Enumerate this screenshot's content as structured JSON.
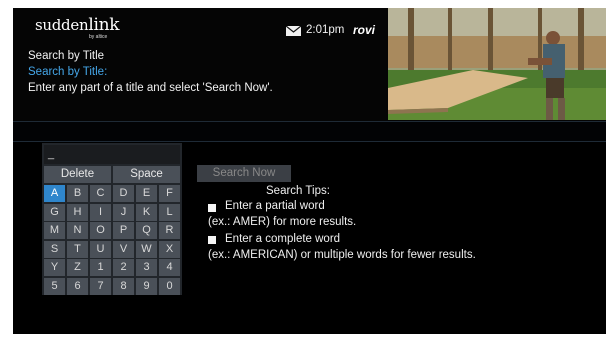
{
  "header": {
    "logo": {
      "brand": "sudden",
      "brand_bold": "link",
      "sub": "by altice"
    },
    "title": "Search by Title",
    "subtitle": "Search by Title:",
    "instruction": "Enter any part of a title and select 'Search Now'.",
    "time": "2:01pm",
    "provider": "rovi",
    "mail_icon": "envelope-icon"
  },
  "keyboard": {
    "input_value": "_",
    "delete_label": "Delete",
    "space_label": "Space",
    "rows": [
      [
        "A",
        "B",
        "C",
        "D",
        "E",
        "F"
      ],
      [
        "G",
        "H",
        "I",
        "J",
        "K",
        "L"
      ],
      [
        "M",
        "N",
        "O",
        "P",
        "Q",
        "R"
      ],
      [
        "S",
        "T",
        "U",
        "V",
        "W",
        "X"
      ],
      [
        "Y",
        "Z",
        "1",
        "2",
        "3",
        "4"
      ],
      [
        "5",
        "6",
        "7",
        "8",
        "9",
        "0"
      ]
    ],
    "selected": "A"
  },
  "search": {
    "button_label": "Search Now",
    "tips_title": "Search Tips:",
    "tip1": "Enter a partial word",
    "tip1_example": "(ex.: AMER) for more results.",
    "tip2": "Enter a complete word",
    "tip2_example": "(ex.: AMERICAN) or multiple words for fewer results."
  },
  "colors": {
    "accent": "#45a6e8",
    "selected_key": "#2f86cc",
    "key": "#4a5058"
  }
}
